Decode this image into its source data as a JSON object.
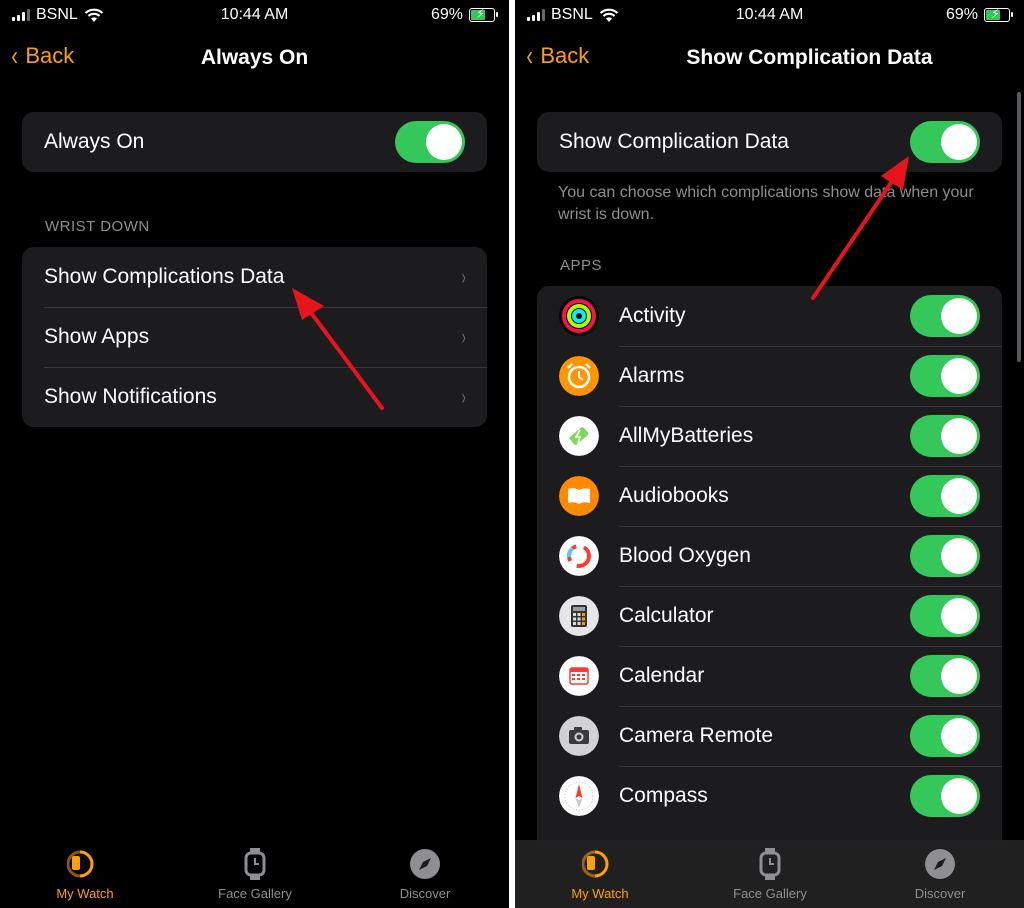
{
  "left_screen": {
    "status": {
      "carrier": "BSNL",
      "time": "10:44 AM",
      "battery": "69%"
    },
    "nav": {
      "back": "Back",
      "title": "Always On"
    },
    "always_on": {
      "label": "Always On",
      "on": true
    },
    "section": "WRIST DOWN",
    "items": [
      {
        "label": "Show Complications Data"
      },
      {
        "label": "Show Apps"
      },
      {
        "label": "Show Notifications"
      }
    ],
    "tabs": [
      {
        "label": "My Watch",
        "active": true
      },
      {
        "label": "Face Gallery",
        "active": false
      },
      {
        "label": "Discover",
        "active": false
      }
    ]
  },
  "right_screen": {
    "status": {
      "carrier": "BSNL",
      "time": "10:44 AM",
      "battery": "69%"
    },
    "nav": {
      "back": "Back",
      "title": "Show Complication Data"
    },
    "main_toggle": {
      "label": "Show Complication Data",
      "on": true
    },
    "footer": "You can choose which complications show data when your wrist is down.",
    "section": "APPS",
    "apps": [
      {
        "name": "Activity",
        "icon": "activity-icon",
        "on": true
      },
      {
        "name": "Alarms",
        "icon": "alarm-clock-icon",
        "on": true
      },
      {
        "name": "AllMyBatteries",
        "icon": "battery-icon",
        "on": true
      },
      {
        "name": "Audiobooks",
        "icon": "book-icon",
        "on": true
      },
      {
        "name": "Blood Oxygen",
        "icon": "blood-oxygen-icon",
        "on": true
      },
      {
        "name": "Calculator",
        "icon": "calculator-icon",
        "on": true
      },
      {
        "name": "Calendar",
        "icon": "calendar-icon",
        "on": true
      },
      {
        "name": "Camera Remote",
        "icon": "camera-icon",
        "on": true
      },
      {
        "name": "Compass",
        "icon": "compass-icon",
        "on": true
      }
    ],
    "tabs": [
      {
        "label": "My Watch",
        "active": true
      },
      {
        "label": "Face Gallery",
        "active": false
      },
      {
        "label": "Discover",
        "active": false
      }
    ]
  },
  "colors": {
    "accent": "#ff9f0a",
    "toggle_on": "#34c759",
    "annotation": "#e8141c"
  }
}
